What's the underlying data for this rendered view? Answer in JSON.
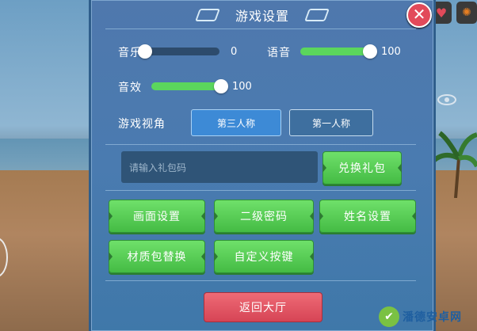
{
  "title": "游戏设置",
  "close_symbol": "✕",
  "music": {
    "label": "音乐",
    "value": "0",
    "level": 0
  },
  "voice": {
    "label": "语音",
    "value": "100",
    "level": 100
  },
  "sfx": {
    "label": "音效",
    "value": "100",
    "level": 100
  },
  "view": {
    "label": "游戏视角",
    "options": [
      "第三人称",
      "第一人称"
    ],
    "selected": "第三人称"
  },
  "gift": {
    "placeholder": "请输入礼包码",
    "redeem_label": "兑换礼包"
  },
  "buttons": [
    "画面设置",
    "二级密码",
    "姓名设置",
    "材质包替换",
    "自定义按键"
  ],
  "back_label": "返回大厅",
  "watermark": "潘德安卓网",
  "colors": {
    "panel": "#4a7bb0",
    "green": "#5bd65d",
    "red": "#e24a5a",
    "accent": "#3d8ad6"
  }
}
